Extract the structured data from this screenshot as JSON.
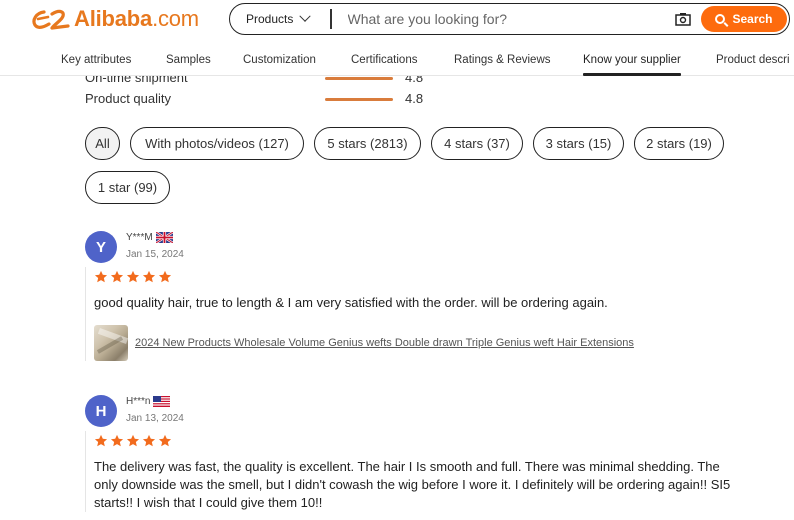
{
  "header": {
    "brand": "Alibaba",
    "brand_suffix": ".com",
    "brand_color": "#e7781e",
    "search": {
      "category": "Products",
      "placeholder": "What are you looking for?",
      "button_label": "Search",
      "button_color": "#fd6b0e",
      "icons": [
        "chevron-down-icon",
        "camera-icon",
        "search-icon"
      ]
    },
    "nav": [
      {
        "label": "Key attributes",
        "active": false
      },
      {
        "label": "Samples",
        "active": false
      },
      {
        "label": "Customization",
        "active": false
      },
      {
        "label": "Certifications",
        "active": false
      },
      {
        "label": "Ratings & Reviews",
        "active": false
      },
      {
        "label": "Know your supplier",
        "active": true
      },
      {
        "label": "Product descri",
        "active": false
      }
    ]
  },
  "ratings": [
    {
      "label": "On-time shipment",
      "value": "4.8",
      "score": 4.8
    },
    {
      "label": "Product quality",
      "value": "4.8",
      "score": 4.8
    }
  ],
  "filters": [
    {
      "label": "All",
      "active": true
    },
    {
      "label": "With photos/videos (127)",
      "active": false
    },
    {
      "label": "5 stars (2813)",
      "active": false
    },
    {
      "label": "4 stars (37)",
      "active": false
    },
    {
      "label": "3 stars (15)",
      "active": false
    },
    {
      "label": "2 stars (19)",
      "active": false
    },
    {
      "label": "1 star (99)",
      "active": false
    }
  ],
  "reviews": [
    {
      "initial": "Y",
      "name": "Y***M",
      "country_flag": "uk-flag-icon",
      "date": "Jan 15, 2024",
      "stars": 5,
      "text": "good quality hair, true to length & I am very satisfied with the order. will be ordering again.",
      "product": "2024 New Products Wholesale Volume Genius wefts Double drawn Triple Genius weft Hair Extensions"
    },
    {
      "initial": "H",
      "name": "H***n",
      "country_flag": "us-flag-icon",
      "date": "Jan 13, 2024",
      "stars": 5,
      "text": "The delivery was fast, the quality is excellent. The hair I Is smooth and full. There was minimal shedding. The only downside was the smell, but I didn't cowash the wig before I wore it. I definitely will be ordering again!! SI5 starts!! I wish that I could give them 10!!"
    }
  ],
  "colors": {
    "star": "#f26b1d",
    "avatar": "#4f63c9",
    "rating_bar": "#d97c3c"
  }
}
